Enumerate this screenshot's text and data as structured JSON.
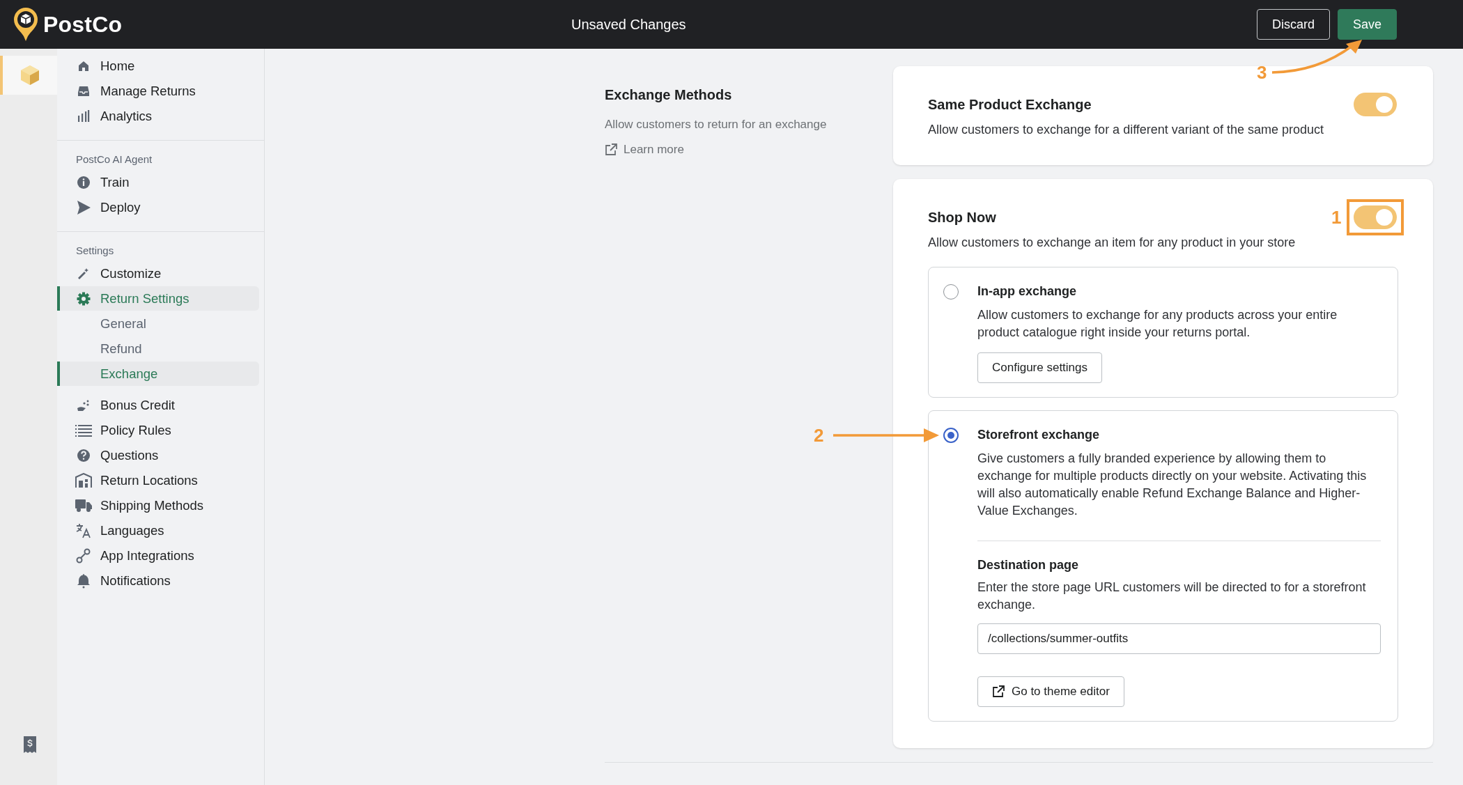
{
  "topbar": {
    "brand": "PostCo",
    "title": "Unsaved Changes",
    "buttons": [
      {
        "label": "Discard",
        "kind": "secondary"
      },
      {
        "label": "Save",
        "kind": "primary",
        "annotation": "3"
      }
    ]
  },
  "rail": {
    "items": [
      {
        "selected": true
      },
      {
        "selected": false
      }
    ]
  },
  "sidebar": {
    "sections": [
      {
        "items": [
          {
            "label": "Home",
            "selected": false
          },
          {
            "label": "Manage Returns",
            "selected": false
          },
          {
            "label": "Analytics",
            "selected": false
          }
        ]
      },
      {
        "heading": "PostCo AI Agent",
        "items": [
          {
            "label": "Train",
            "selected": false
          },
          {
            "label": "Deploy",
            "selected": false
          }
        ]
      },
      {
        "heading": "Settings",
        "items": [
          {
            "label": "Customize",
            "selected": false
          },
          {
            "label": "Return Settings",
            "selected": true,
            "children": [
              {
                "label": "General",
                "selected": false
              },
              {
                "label": "Refund",
                "selected": false
              },
              {
                "label": "Exchange",
                "selected": true
              }
            ]
          },
          {
            "label": "Bonus Credit",
            "selected": false
          },
          {
            "label": "Policy Rules",
            "selected": false
          },
          {
            "label": "Questions",
            "selected": false
          },
          {
            "label": "Return Locations",
            "selected": false
          },
          {
            "label": "Shipping Methods",
            "selected": false
          },
          {
            "label": "Languages",
            "selected": false
          },
          {
            "label": "App Integrations",
            "selected": false
          },
          {
            "label": "Notifications",
            "selected": false
          }
        ]
      }
    ]
  },
  "intro": {
    "title": "Exchange Methods",
    "description": "Allow customers to return for an exchange",
    "link": "Learn more"
  },
  "cards": [
    {
      "title": "Same Product Exchange",
      "description": "Allow customers to exchange for a different variant of the same product",
      "on": true
    },
    {
      "title": "Shop Now",
      "description": "Allow customers to exchange an item for any product in your store",
      "on": true,
      "annotation": "1",
      "options": [
        {
          "title": "In-app exchange",
          "description": "Allow customers to exchange for any products across your entire product catalogue right inside your returns portal.",
          "selected": false,
          "button": "Configure settings"
        },
        {
          "title": "Storefront exchange",
          "description": "Give customers a fully branded experience by allowing them to exchange for multiple products directly on your website. Activating this will also automatically enable Refund Exchange Balance and Higher-Value Exchanges.",
          "selected": true,
          "annotation": "2",
          "destination": {
            "title": "Destination page",
            "description": "Enter the store page URL customers will be directed to for a storefront exchange.",
            "value": "/collections/summer-outfits"
          },
          "button": "Go to theme editor"
        }
      ]
    }
  ]
}
